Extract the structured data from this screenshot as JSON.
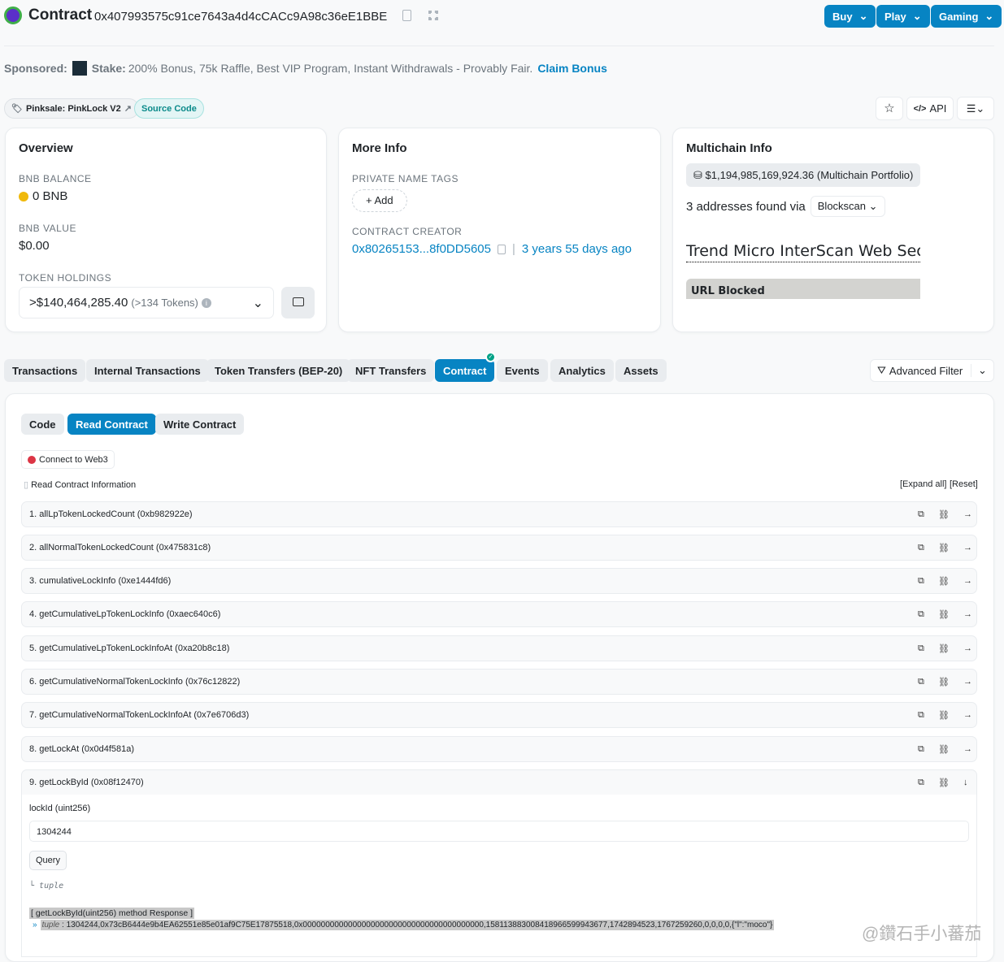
{
  "header": {
    "title": "Contract",
    "address": "0x407993575c91ce7643a4d4cCACc9A98c36eE1BBE",
    "buttons": [
      "Buy",
      "Play",
      "Gaming"
    ]
  },
  "sponsored": {
    "label": "Sponsored:",
    "brand": "Stake:",
    "text": "200% Bonus, 75k Raffle, Best VIP Program, Instant Withdrawals - Provably Fair.",
    "cta": "Claim Bonus"
  },
  "tags": {
    "name_tag": "Pinksale: PinkLock V2",
    "source": "Source Code",
    "api": "API"
  },
  "overview": {
    "title": "Overview",
    "bal_label": "BNB BALANCE",
    "bal": "0 BNB",
    "value_label": "BNB VALUE",
    "value": "$0.00",
    "holdings_label": "TOKEN HOLDINGS",
    "holdings": ">$140,464,285.40",
    "tokens": "(>134 Tokens)"
  },
  "more": {
    "title": "More Info",
    "tags_label": "PRIVATE NAME TAGS",
    "add": "Add",
    "creator_label": "CONTRACT CREATOR",
    "creator": "0x80265153...8f0DD5605",
    "age": "3 years 55 days ago"
  },
  "multi": {
    "title": "Multichain Info",
    "portfolio": "$1,194,985,169,924.36 (Multichain Portfolio)",
    "found": "3 addresses found via",
    "via": "Blockscan",
    "blocked_title": "Trend Micro InterScan Web Secu",
    "blocked": "URL Blocked"
  },
  "tabs": [
    "Transactions",
    "Internal Transactions",
    "Token Transfers (BEP-20)",
    "NFT Transfers",
    "Contract",
    "Events",
    "Analytics",
    "Assets"
  ],
  "adv_filter": "Advanced Filter",
  "subtabs": [
    "Code",
    "Read Contract",
    "Write Contract"
  ],
  "connect": "Connect to Web3",
  "read_info": "Read Contract Information",
  "expand": "[Expand all]",
  "reset": "[Reset]",
  "methods": [
    "1. allLpTokenLockedCount (0xb982922e)",
    "2. allNormalTokenLockedCount (0x475831c8)",
    "3. cumulativeLockInfo (0xe1444fd6)",
    "4. getCumulativeLpTokenLockInfo (0xaec640c6)",
    "5. getCumulativeLpTokenLockInfoAt (0xa20b8c18)",
    "6. getCumulativeNormalTokenLockInfo (0x76c12822)",
    "7. getCumulativeNormalTokenLockInfoAt (0x7e6706d3)",
    "8. getLockAt (0x0d4f581a)",
    "9. getLockById (0x08f12470)"
  ],
  "query": {
    "param": "lockId (uint256)",
    "value": "1304244",
    "button": "Query",
    "ret": "tuple",
    "resp_title": "[ getLockById(uint256) method Response ]",
    "resp_type": "tuple",
    "resp_value": "1304244,0x73cB6444e9b4EA62551e85e01af9C75E17875518,0x0000000000000000000000000000000000000000,158113883008418966599943677,1742894523,1767259260,0,0,0,0,{\"l\":\"moco\"}"
  },
  "watermark": "@鑽石手小蕃茄"
}
